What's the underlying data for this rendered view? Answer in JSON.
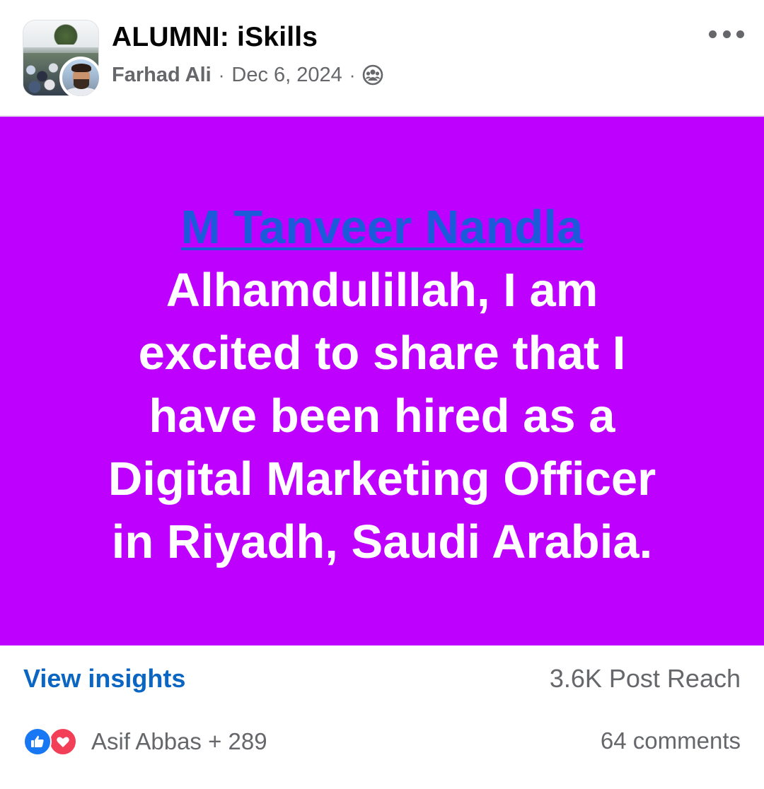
{
  "post": {
    "group_name": "ALUMNI: iSkills",
    "author": "Farhad Ali",
    "separator": "·",
    "date": "Dec 6, 2024",
    "audience_icon": "members-group-icon",
    "more_icon": "more-options-icon",
    "background_color": "#be00ff",
    "mention": "M Tanveer Nandla",
    "mention_color": "#1b5ad9",
    "body_lines": [
      "Alhamdulillah, I am",
      "excited to share that I",
      "have been hired as a",
      "Digital Marketing Officer",
      "in Riyadh, Saudi Arabia."
    ]
  },
  "insights": {
    "link_label": "View insights",
    "reach_label": "3.6K Post Reach"
  },
  "reactions": {
    "icons": [
      "like-icon",
      "love-icon"
    ],
    "summary": "Asif Abbas + 289",
    "comments_label": "64 comments"
  },
  "colors": {
    "link_blue": "#0a66c2",
    "secondary_text": "#65676b",
    "like_blue": "#1877f2",
    "love_red": "#f33e58"
  }
}
